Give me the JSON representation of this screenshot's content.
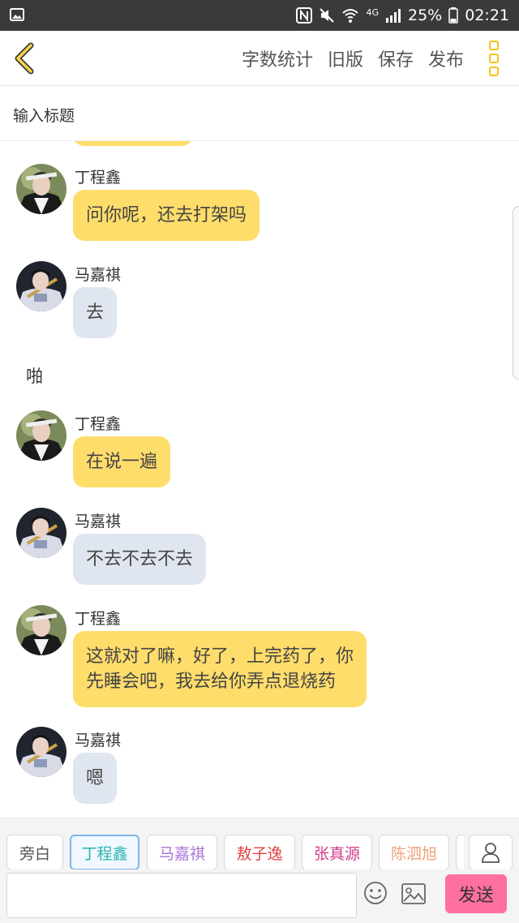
{
  "status_bar": {
    "battery": "25%",
    "time": "02:21",
    "network": "4G"
  },
  "header": {
    "actions": [
      {
        "label": "字数统计"
      },
      {
        "label": "旧版"
      },
      {
        "label": "保存"
      },
      {
        "label": "发布"
      }
    ]
  },
  "title_field": {
    "placeholder": "输入标题"
  },
  "messages": [
    {
      "sender": "丁程鑫",
      "text": "问你呢，还去打架吗",
      "style": "yellow",
      "avatar": "avatar-dingchengxin"
    },
    {
      "sender": "马嘉祺",
      "text": "去",
      "style": "grey",
      "avatar": "avatar-majiaqi"
    },
    {
      "narration": "啪"
    },
    {
      "sender": "丁程鑫",
      "text": "在说一遍",
      "style": "yellow",
      "avatar": "avatar-dingchengxin"
    },
    {
      "sender": "马嘉祺",
      "text": "不去不去不去",
      "style": "grey",
      "avatar": "avatar-majiaqi"
    },
    {
      "sender": "丁程鑫",
      "text_lines": [
        "这就对了嘛，好了，上完药了，你",
        "先睡会吧，我去给你弄点退烧药"
      ],
      "style": "yellow",
      "avatar": "avatar-dingchengxin"
    },
    {
      "sender": "马嘉祺",
      "text": "嗯",
      "style": "grey",
      "avatar": "avatar-majiaqi"
    }
  ],
  "characters": [
    {
      "label": "旁白",
      "color": "#555555"
    },
    {
      "label": "丁程鑫",
      "color": "#2ab5b0",
      "selected": true
    },
    {
      "label": "马嘉祺",
      "color": "#a874d6"
    },
    {
      "label": "敖子逸",
      "color": "#e0413f"
    },
    {
      "label": "张真源",
      "color": "#d43d8e"
    },
    {
      "label": "陈泗旭",
      "color": "#f0a27a"
    }
  ],
  "input": {
    "value": "",
    "send_label": "发送"
  },
  "colors": {
    "accent_yellow": "#fedd6b",
    "bubble_grey": "#e0e6ef",
    "send_pink": "#ff6fa0",
    "status_bar": "#3a3a3a"
  }
}
